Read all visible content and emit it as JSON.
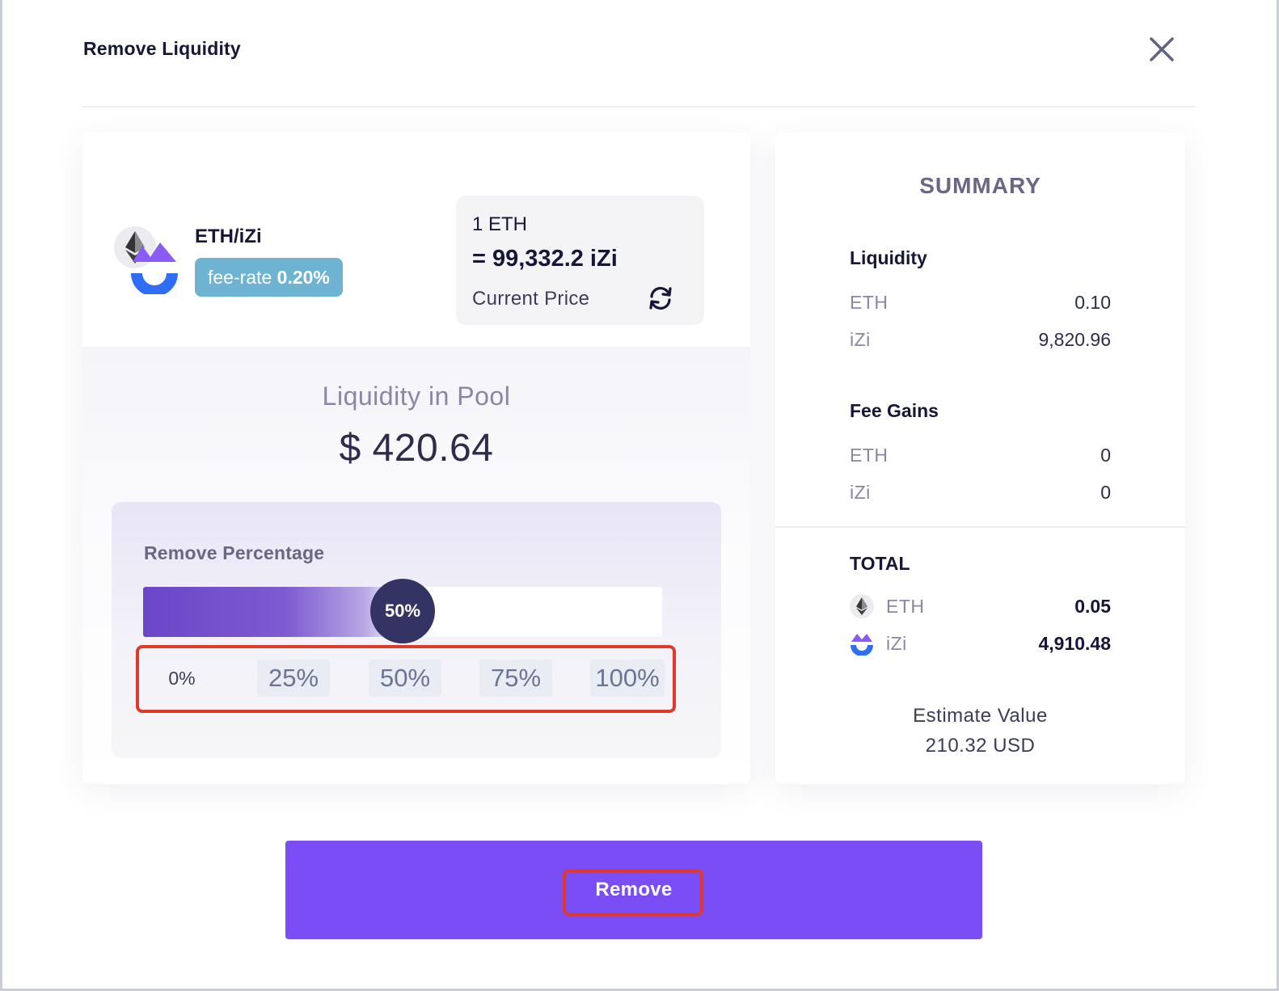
{
  "modal": {
    "title": "Remove Liquidity"
  },
  "pool": {
    "pair": "ETH/iZi",
    "fee_label": "fee-rate",
    "fee_value": "0.20%",
    "price_line1": "1 ETH",
    "price_line2": "= 99,332.2 iZi",
    "price_caption": "Current Price",
    "liquidity_title": "Liquidity in Pool",
    "liquidity_value": "$ 420.64"
  },
  "remove_percentage": {
    "label": "Remove Percentage",
    "current": 0.5,
    "thumb_label": "50%",
    "options": [
      "0%",
      "25%",
      "50%",
      "75%",
      "100%"
    ]
  },
  "summary": {
    "title": "SUMMARY",
    "liquidity": {
      "heading": "Liquidity",
      "rows": [
        {
          "token": "ETH",
          "value": "0.10"
        },
        {
          "token": "iZi",
          "value": "9,820.96"
        }
      ]
    },
    "fee_gains": {
      "heading": "Fee Gains",
      "rows": [
        {
          "token": "ETH",
          "value": "0"
        },
        {
          "token": "iZi",
          "value": "0"
        }
      ]
    },
    "total": {
      "heading": "TOTAL",
      "rows": [
        {
          "token": "ETH",
          "value": "0.05",
          "icon": "eth-icon"
        },
        {
          "token": "iZi",
          "value": "4,910.48",
          "icon": "izi-icon"
        }
      ]
    },
    "estimate_label": "Estimate Value",
    "estimate_value": "210.32 USD"
  },
  "actions": {
    "remove_label": "Remove"
  },
  "colors": {
    "primary": "#7a4df5",
    "fee_badge": "#6fb3d3",
    "thumb": "#333463",
    "highlight": "#e0392b"
  }
}
